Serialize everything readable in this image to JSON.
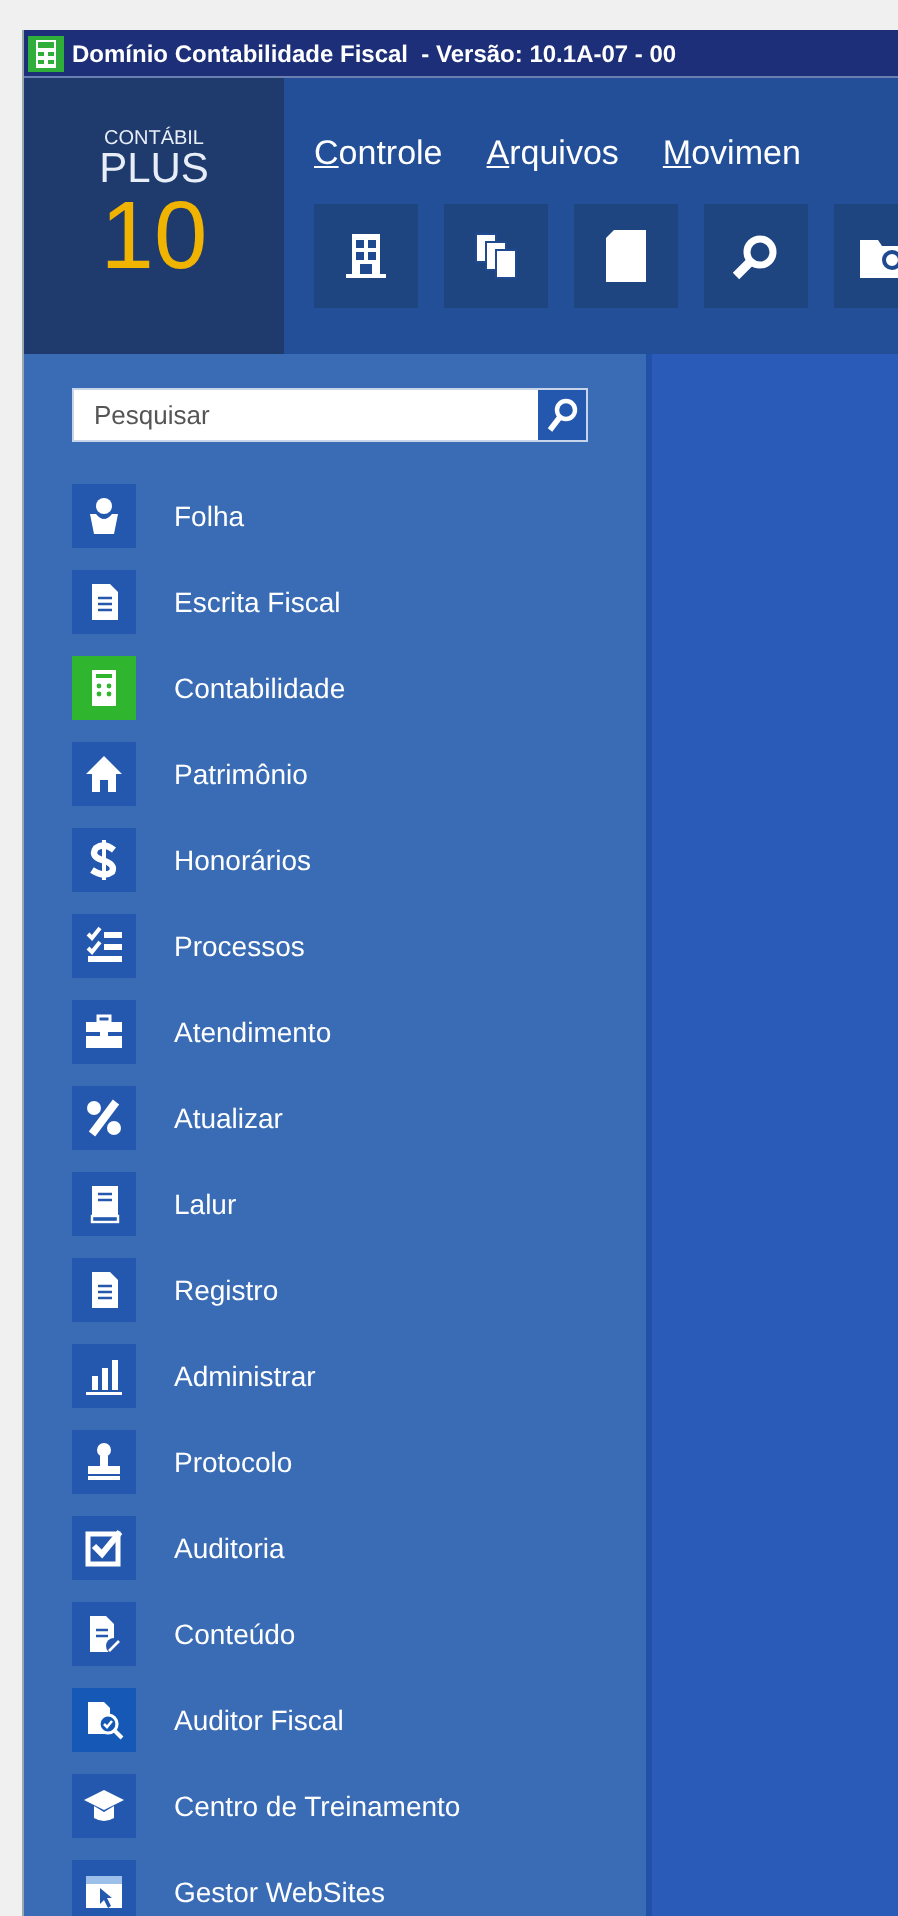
{
  "window": {
    "title": "Domínio Contabilidade Fiscal  - Versão: 10.1A-07 - 00"
  },
  "logo": {
    "line_1": "CONTÁBIL",
    "line_2": "PLUS",
    "line_3": "10"
  },
  "menu": [
    {
      "label": "Controle",
      "underline_first": true
    },
    {
      "label": "Arquivos",
      "underline_first": true
    },
    {
      "label": "Movimen",
      "underline_first": true
    }
  ],
  "search": {
    "placeholder": "Pesquisar"
  },
  "sidebar": {
    "items": [
      {
        "label": "Folha",
        "selected": false,
        "hovered": false
      },
      {
        "label": "Escrita Fiscal",
        "selected": false,
        "hovered": false
      },
      {
        "label": "Contabilidade",
        "selected": true,
        "hovered": false
      },
      {
        "label": "Patrimônio",
        "selected": false,
        "hovered": false
      },
      {
        "label": "Honorários",
        "selected": false,
        "hovered": false
      },
      {
        "label": "Processos",
        "selected": false,
        "hovered": false
      },
      {
        "label": "Atendimento",
        "selected": false,
        "hovered": false
      },
      {
        "label": "Atualizar",
        "selected": false,
        "hovered": false
      },
      {
        "label": "Lalur",
        "selected": false,
        "hovered": false
      },
      {
        "label": "Registro",
        "selected": false,
        "hovered": false
      },
      {
        "label": "Administrar",
        "selected": false,
        "hovered": false
      },
      {
        "label": "Protocolo",
        "selected": false,
        "hovered": false
      },
      {
        "label": "Auditoria",
        "selected": false,
        "hovered": false
      },
      {
        "label": "Conteúdo",
        "selected": false,
        "hovered": false
      },
      {
        "label": "Auditor Fiscal",
        "selected": false,
        "hovered": true
      },
      {
        "label": "Centro de Treinamento",
        "selected": false,
        "hovered": false
      },
      {
        "label": "Gestor WebSites",
        "selected": false,
        "hovered": false
      }
    ]
  }
}
